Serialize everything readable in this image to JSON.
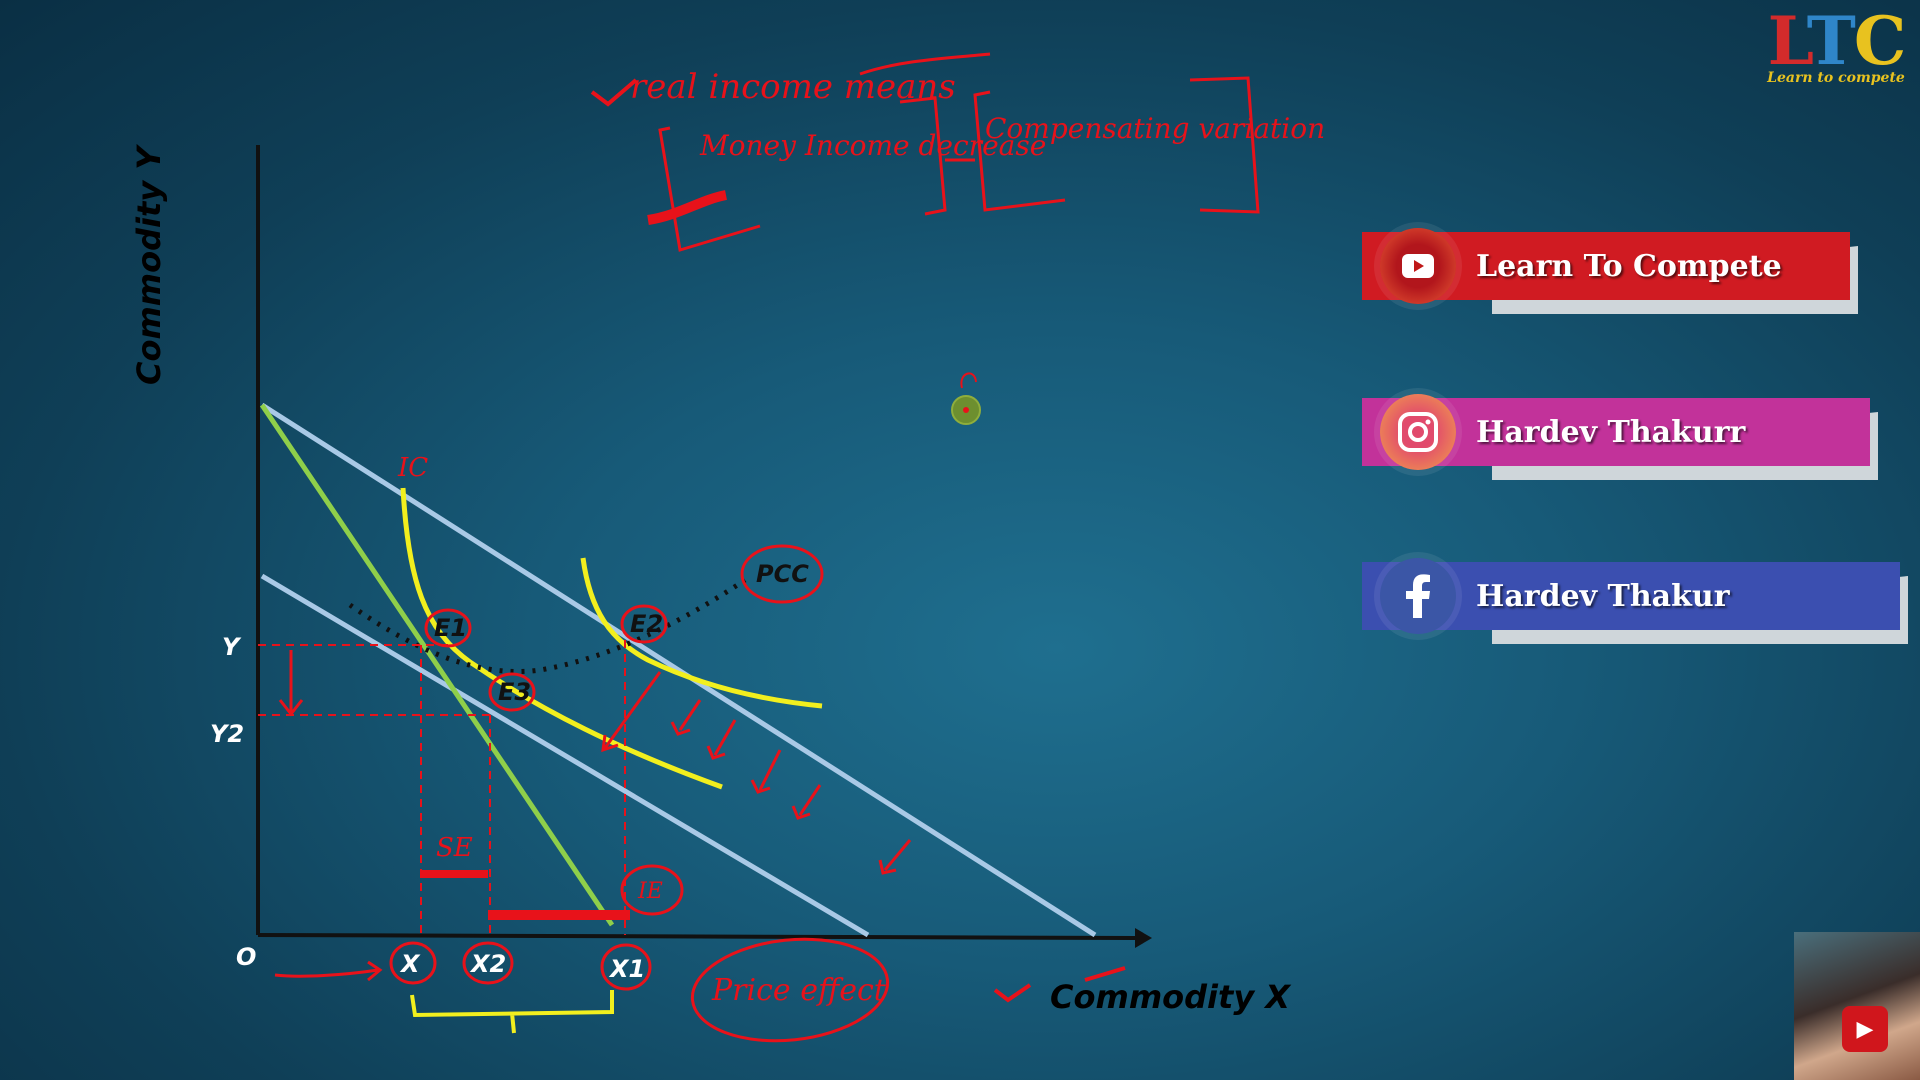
{
  "diagram": {
    "y_axis_label": "Commodity Y",
    "x_axis_label": "Commodity X",
    "origin_label": "O",
    "y_ticks": [
      "Y",
      "Y2"
    ],
    "x_ticks": [
      "X",
      "X2",
      "X1"
    ],
    "points": [
      "E1",
      "E2",
      "E3"
    ],
    "curve_labels": {
      "ic": "IC",
      "pcc": "PCC"
    },
    "effect_labels": {
      "substitution": "SE",
      "income": "IE"
    },
    "annotations": {
      "top_note": "real income means",
      "box_left": "Money Income decrease",
      "box_right": "Compensating variation",
      "bottom_note": "Price effect"
    }
  },
  "logo": {
    "letters": [
      "L",
      "T",
      "C"
    ],
    "tagline": "Learn to compete"
  },
  "social": {
    "youtube": "Learn To Compete",
    "instagram": "Hardev Thakurr",
    "facebook": "Hardev Thakur"
  },
  "colors": {
    "budget_line": "#a9c9e6",
    "new_budget_line": "#8fcf4a",
    "indifference_curve": "#f2ef1e",
    "annotation": "#e8121a",
    "youtube": "#d01b22",
    "instagram": "#c2329a",
    "facebook": "#3b4fb0"
  },
  "icons": [
    "youtube-icon",
    "instagram-icon",
    "facebook-icon",
    "subscribe-icon"
  ]
}
